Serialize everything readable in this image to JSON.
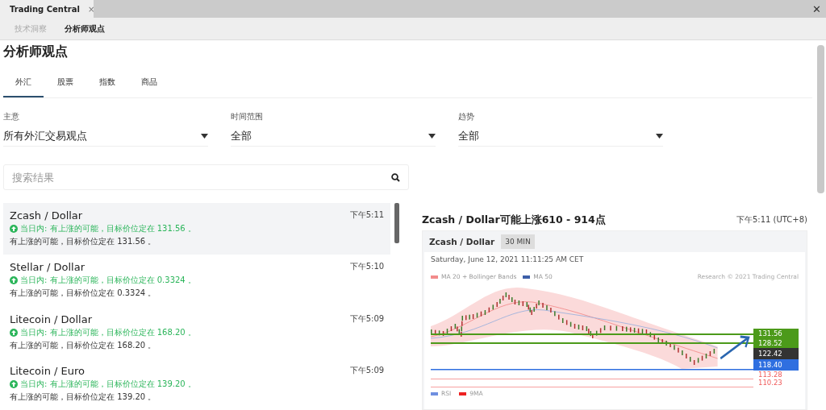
{
  "window": {
    "tabs": [
      {
        "label": "Trading Central",
        "close": "×",
        "selected": true
      }
    ],
    "close": "✕"
  },
  "subtabs": [
    {
      "label": "技术洞察",
      "selected": false
    },
    {
      "label": "分析师观点",
      "selected": true
    }
  ],
  "page_title": "分析师观点",
  "categories": [
    {
      "label": "外汇",
      "selected": true
    },
    {
      "label": "股票",
      "selected": false
    },
    {
      "label": "指数",
      "selected": false
    },
    {
      "label": "商品",
      "selected": false
    }
  ],
  "filters": [
    {
      "label": "主意",
      "value": "所有外汇交易观点"
    },
    {
      "label": "时间范围",
      "value": "全部"
    },
    {
      "label": "趋势",
      "value": "全部"
    }
  ],
  "search": {
    "placeholder": "搜索结果"
  },
  "ideas": [
    {
      "name": "Zcash / Dollar",
      "time": "下午5:11",
      "headline": "当日内: 有上涨的可能，目标价位定在 131.56 。",
      "summary": "有上涨的可能，目标价位定在 131.56 。",
      "selected": true
    },
    {
      "name": "Stellar / Dollar",
      "time": "下午5:10",
      "headline": "当日内: 有上涨的可能，目标价位定在 0.3324 。",
      "summary": "有上涨的可能，目标价位定在 0.3324 。",
      "selected": false
    },
    {
      "name": "Litecoin / Dollar",
      "time": "下午5:09",
      "headline": "当日内: 有上涨的可能，目标价位定在 168.20 。",
      "summary": "有上涨的可能，目标价位定在 168.20 。",
      "selected": false
    },
    {
      "name": "Litecoin / Euro",
      "time": "下午5:09",
      "headline": "当日内: 有上涨的可能，目标价位定在 139.20 。",
      "summary": "有上涨的可能，目标价位定在 139.20 。",
      "selected": false
    }
  ],
  "detail": {
    "title": "Zcash / Dollar可能上涨610 - 914点",
    "time": "下午5:11 (UTC+8)",
    "chart": {
      "symbol": "Zcash / Dollar",
      "interval": "30 MIN",
      "date": "Saturday, June 12, 2021 11:11:25 AM CET",
      "copyright": "Research © 2021 Trading Central",
      "legend": [
        {
          "label": "MA 20 + Bollinger Bands",
          "color": "#f28b8b"
        },
        {
          "label": "MA 50",
          "color": "#3d5fa8"
        }
      ],
      "levels": [
        {
          "label": "131.56",
          "color": "#4c9a1a"
        },
        {
          "label": "128.52",
          "color": "#4c9a1a"
        },
        {
          "label": "122.42",
          "color": "#333333"
        },
        {
          "label": "118.40",
          "color": "#2f6fe0"
        },
        {
          "label": "113.28",
          "color": "#f05a5a"
        },
        {
          "label": "110.23",
          "color": "#f05a5a"
        }
      ],
      "lower_legend": [
        {
          "label": "RSI",
          "color": "#6f8fe0"
        },
        {
          "label": "9MA",
          "color": "#ee2222"
        }
      ]
    }
  }
}
